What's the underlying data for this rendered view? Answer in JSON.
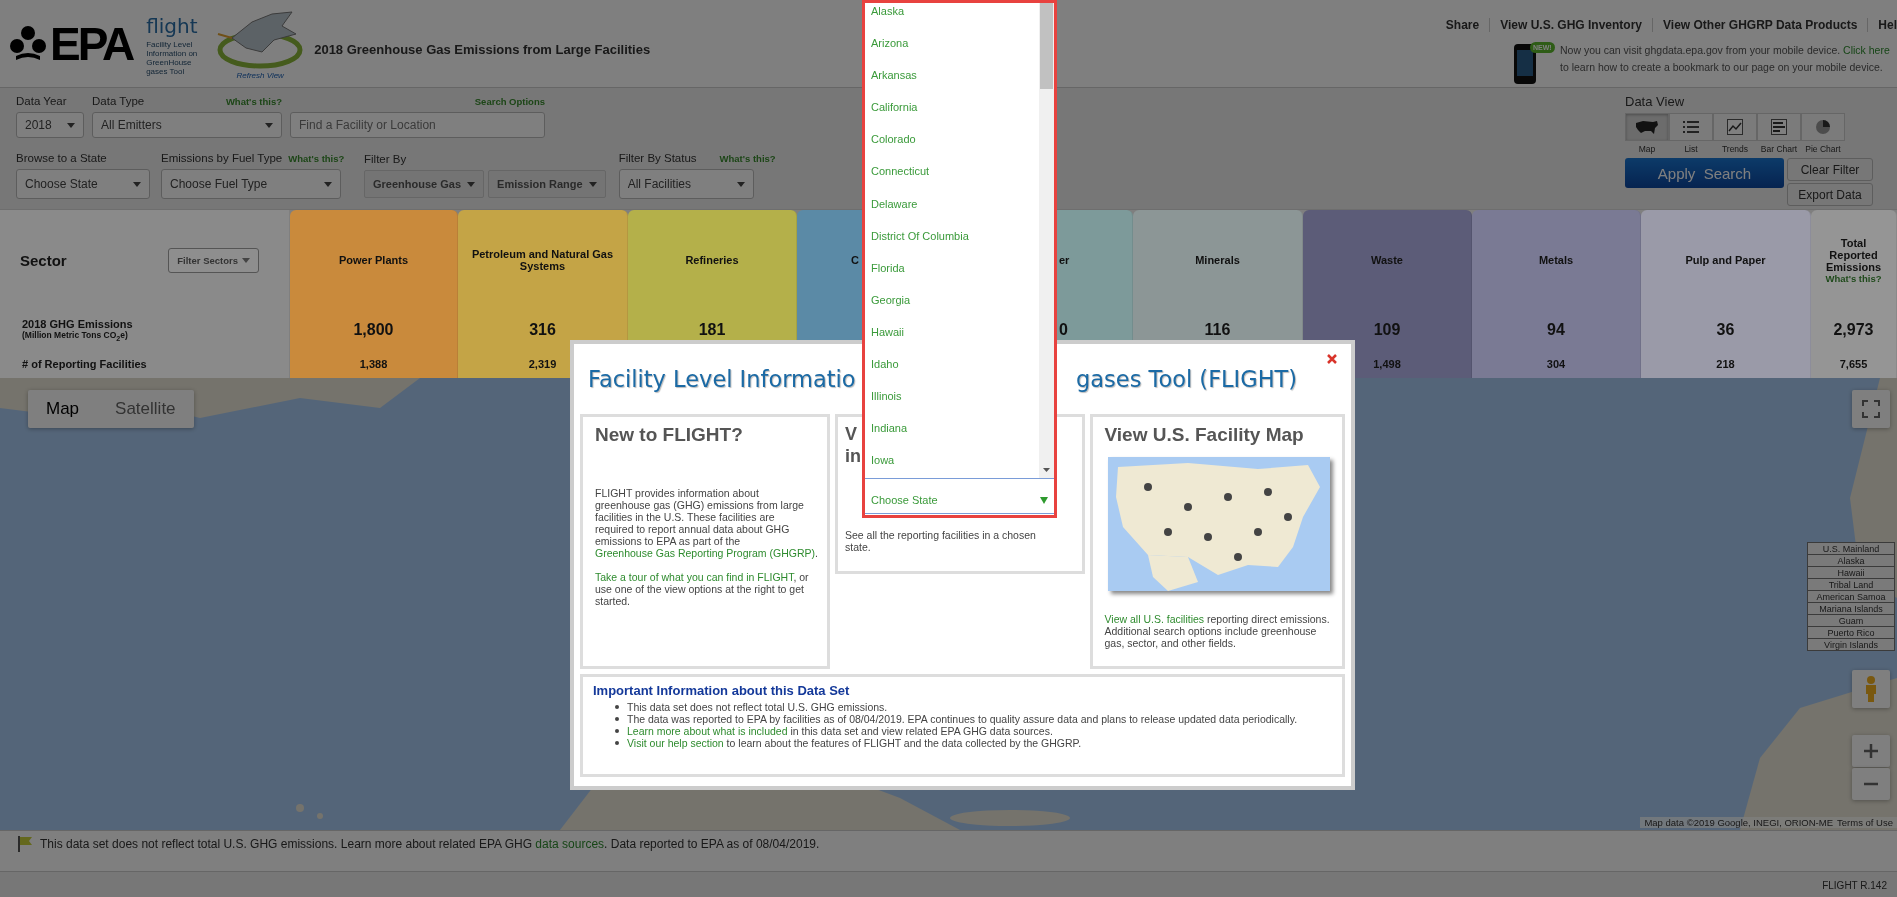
{
  "header": {
    "logo_text": "EPA",
    "app_logo": {
      "name": "flight",
      "tagline": "Facility Level Information on GreenHouse gases Tool",
      "refresh": "Refresh View"
    },
    "title": "2018 Greenhouse Gas Emissions from Large Facilities",
    "links": [
      "Share",
      "View U.S. GHG Inventory",
      "View Other GHGRP Data Products",
      "Hel"
    ],
    "mobile_notice": {
      "badge": "NEW!",
      "before": "Now you can visit ghgdata.epa.gov from your mobile device. ",
      "link": "Click here",
      "after": " to learn how to create a bookmark to our page on your mobile device."
    }
  },
  "filters": {
    "data_year": {
      "label": "Data Year",
      "value": "2018"
    },
    "data_type": {
      "label": "Data Type",
      "help": "What's this?",
      "value": "All Emitters"
    },
    "search": {
      "options_link": "Search Options",
      "placeholder": "Find a Facility or Location"
    },
    "state": {
      "label": "Browse to a State",
      "value": "Choose State"
    },
    "fuel": {
      "label": "Emissions by Fuel Type",
      "help": "What's this?",
      "value": "Choose Fuel Type"
    },
    "filter_by": {
      "label": "Filter By",
      "buttons": [
        "Greenhouse Gas",
        "Emission Range"
      ]
    },
    "status": {
      "label": "Filter By Status",
      "help": "What's this?",
      "value": "All Facilities"
    }
  },
  "data_view": {
    "label": "Data View",
    "views": [
      {
        "label": "Map",
        "kind": "map",
        "selected": true
      },
      {
        "label": "List",
        "kind": "list",
        "selected": false
      },
      {
        "label": "Trends",
        "kind": "trends",
        "selected": false
      },
      {
        "label": "Bar Chart",
        "kind": "bar",
        "selected": false
      },
      {
        "label": "Pie Chart",
        "kind": "pie",
        "selected": false
      }
    ],
    "apply": "Apply  Search",
    "clear": "Clear Filter",
    "export": "Export Data"
  },
  "sectors": {
    "title": "Sector",
    "filter_button": "Filter Sectors",
    "emissions_label": "2018 GHG Emissions",
    "emissions_unit": "(Million Metric Tons CO$_{2}$e)",
    "facilities_label": "# of Reporting Facilities",
    "columns": [
      {
        "name": "Power Plants",
        "color": "#c98a3c",
        "emissions": "1,800",
        "facilities": "1,388"
      },
      {
        "name": "Petroleum and Natural Gas Systems",
        "color": "#c4a446",
        "emissions": "316",
        "facilities": "2,319"
      },
      {
        "name": "Refineries",
        "color": "#b4b04a",
        "emissions": "181"
      },
      {
        "name": "C",
        "color": "#5b8aa6",
        "cut_right": true
      },
      {
        "name": "er",
        "color": "#7d9a9a",
        "cut_left": true,
        "emissions": "0"
      },
      {
        "name": "Minerals",
        "color": "#8c9696",
        "emissions": "116"
      },
      {
        "name": "Waste",
        "color": "#5c5c78",
        "emissions": "109",
        "facilities": "1,498"
      },
      {
        "name": "Metals",
        "color": "#7a7a94",
        "emissions": "94",
        "facilities": "304"
      },
      {
        "name": "Pulp and Paper",
        "color": "#9a9aa8",
        "emissions": "36",
        "facilities": "218"
      }
    ],
    "total": {
      "name": "Total Reported Emissions",
      "help": "What's this?",
      "emissions": "2,973",
      "facilities": "7,655"
    }
  },
  "map": {
    "map_types": [
      {
        "label": "Map",
        "selected": true
      },
      {
        "label": "Satellite",
        "selected": false
      }
    ],
    "regions": [
      "U.S. Mainland",
      "Alaska",
      "Hawaii",
      "Tribal Land",
      "American Samoa",
      "Mariana Islands",
      "Guam",
      "Puerto Rico",
      "Virgin Islands"
    ],
    "attribution": "Map data ©2019 Google, INEGI, ORION-ME",
    "terms": "Terms of Use"
  },
  "status_bar": {
    "runs": [
      {
        "text": "This data set does not reflect total U.S. GHG emissions. Learn more about related EPA GHG "
      },
      {
        "link": "data sources"
      },
      {
        "text": ". Data reported to EPA as of 08/04/2019."
      }
    ]
  },
  "footer": {
    "version": "FLIGHT R.142"
  },
  "modal": {
    "title_left": "Facility Level Informatio",
    "title_right": "gases Tool (FLIGHT)",
    "intro": {
      "title": "New to FLIGHT?",
      "paragraphs": [
        [
          {
            "text": "FLIGHT provides information about greenhouse gas (GHG) emissions from large facilities in the U.S. These facilities are required to report annual data about GHG emissions to EPA as part of the "
          },
          {
            "link": "Greenhouse Gas Reporting Program (GHGRP)"
          },
          {
            "text": "."
          }
        ],
        [
          {
            "link": "Take a tour of what you can find in FLIGHT"
          },
          {
            "text": ", or use one of the view options at the right to get started."
          }
        ]
      ]
    },
    "state_card": {
      "title_lines": [
        "V",
        "in"
      ],
      "text": "See all the reporting facilities in a chosen state."
    },
    "map_card": {
      "title": "View U.S. Facility Map",
      "runs": [
        {
          "link": "View all U.S. facilities"
        },
        {
          "text": " reporting direct emissions. Additional search options include greenhouse gas, sector, and other fields."
        }
      ]
    },
    "info": {
      "title": "Important Information about this Data Set",
      "items": [
        [
          {
            "text": "This data set does not reflect total U.S. GHG emissions."
          }
        ],
        [
          {
            "text": "The data was reported to EPA by facilities as of 08/04/2019. EPA continues to quality assure data and plans to release updated data periodically."
          }
        ],
        [
          {
            "link": "Learn more about what is included"
          },
          {
            "text": " in this data set and view related EPA GHG data sources."
          }
        ],
        [
          {
            "link": "Visit our help section"
          },
          {
            "text": " to learn about the features of FLIGHT and the data collected by the GHGRP."
          }
        ]
      ]
    }
  },
  "state_dropdown": {
    "options": [
      "Alaska",
      "Arizona",
      "Arkansas",
      "California",
      "Colorado",
      "Connecticut",
      "Delaware",
      "District Of Columbia",
      "Florida",
      "Georgia",
      "Hawaii",
      "Idaho",
      "Illinois",
      "Indiana",
      "Iowa"
    ],
    "value": "Choose State"
  }
}
